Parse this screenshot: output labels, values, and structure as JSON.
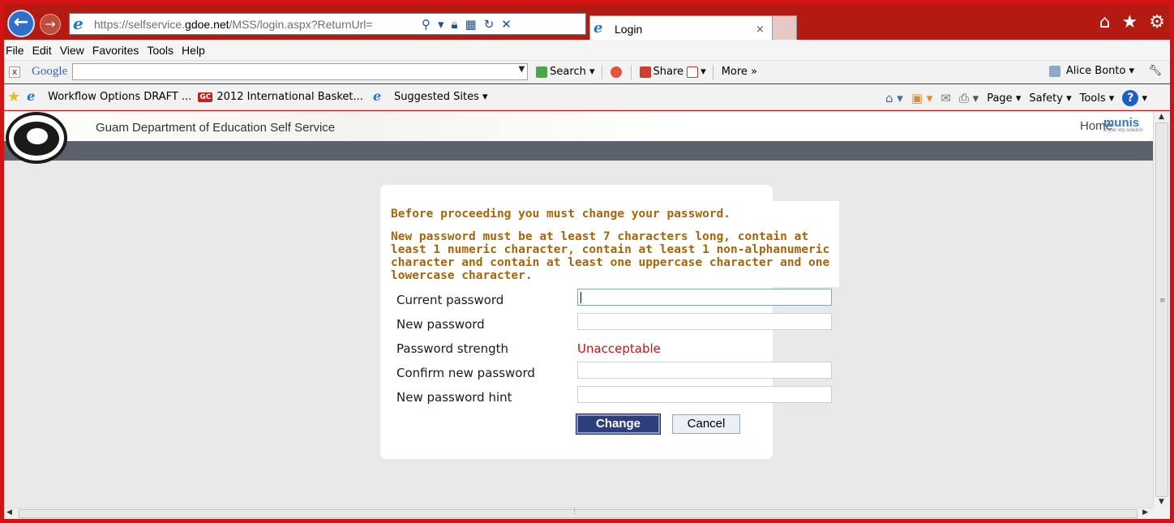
{
  "browser": {
    "back_icon": "back-arrow-icon",
    "forward_icon": "forward-arrow-icon",
    "url_prefix": "https://selfservice.",
    "url_domain": "gdoe.net",
    "url_rest": "/MSS/login.aspx?ReturnUrl=",
    "tab_title": "Login",
    "tab_close": "×",
    "right_icons": [
      "home-icon",
      "favorites-star-icon",
      "settings-gear-icon"
    ],
    "accent_color": "#d41414"
  },
  "menu": {
    "items": [
      "File",
      "Edit",
      "View",
      "Favorites",
      "Tools",
      "Help"
    ]
  },
  "google_toolbar": {
    "close": "x",
    "logo": "Google",
    "search_value": "",
    "search_label": "Search",
    "share_label": "Share",
    "more_label": "More »",
    "user_label": "Alice Bonto"
  },
  "favorites_bar": {
    "items": [
      {
        "label": "Workflow Options DRAFT ...",
        "icon": "ie-page-icon"
      },
      {
        "label": "2012 International Basket...",
        "icon": "gc-badge-icon",
        "badge": "GC"
      },
      {
        "label": "Suggested Sites",
        "icon": "ie-page-icon"
      }
    ],
    "commands": [
      "Page",
      "Safety",
      "Tools"
    ]
  },
  "site": {
    "title": "Guam Department of Education Self Service",
    "home_link": "Home",
    "brand": "munis",
    "brand_tagline": "a tyler erp solution"
  },
  "dialog": {
    "message_1": "Before proceeding you must change your password.",
    "message_2": "New password must be at least 7 characters long, contain at least 1 numeric character, contain at least 1 non-alphanumeric character and contain at least one uppercase character and one lowercase character.",
    "fields": {
      "current_password": {
        "label": "Current password",
        "value": ""
      },
      "new_password": {
        "label": "New password",
        "value": ""
      },
      "password_strength": {
        "label": "Password strength",
        "value": "Unacceptable"
      },
      "confirm_password": {
        "label": "Confirm new password",
        "value": ""
      },
      "password_hint": {
        "label": "New password hint",
        "value": ""
      }
    },
    "change_button": "Change",
    "cancel_button": "Cancel"
  },
  "colors": {
    "warning_text": "#a86508",
    "strength_bad": "#d10f0f",
    "primary_button": "#2c3f7c"
  }
}
